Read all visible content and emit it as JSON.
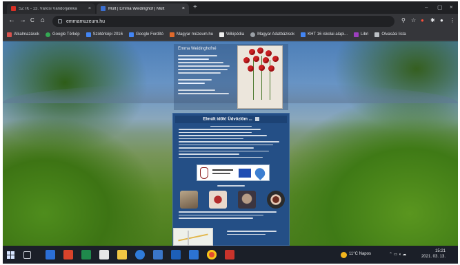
{
  "browser": {
    "tabs": [
      {
        "label": "SZTK - 13. Városi Vándorjátéka"
      },
      {
        "label": "Múlt | Emma Weidinghof | Múlt"
      }
    ],
    "new_tab": "+",
    "window_controls": {
      "minimize": "–",
      "maximize": "▢",
      "close": "×"
    },
    "nav": {
      "back": "←",
      "forward": "→",
      "reload": "C",
      "home": "⌂"
    },
    "url": "emmamuzeum.hu",
    "bookmarks": [
      {
        "label": "Alkalmazások",
        "color": "#d9534f"
      },
      {
        "label": "Google Térkép",
        "color": "#34a853"
      },
      {
        "label": "Szótérképi 2016",
        "color": "#4285f4"
      },
      {
        "label": "Google Fordító",
        "color": "#4285f4"
      },
      {
        "label": "Magyar múzeum.hu",
        "color": "#e06a2b"
      },
      {
        "label": "Wikipédia",
        "color": "#eeeeee"
      },
      {
        "label": "Magyar Adatbázisok",
        "color": "#9aa0a6"
      },
      {
        "label": "KHT 16 iskolai alapi...",
        "color": "#4285f4"
      },
      {
        "label": "Libri",
        "color": "#9c3fbf"
      },
      {
        "label": "Olvasási lista",
        "color": "#bdc1c6"
      }
    ]
  },
  "page": {
    "top_title": "Emma Weidinghofné",
    "section_title": "Elmúlt idők! Üdvözlöm ...",
    "colors": {
      "panel": "#244f86",
      "accent": "#c91f22"
    }
  },
  "taskbar": {
    "weather": "11°C Napos",
    "time": "15:21",
    "date": "2021. 03. 13."
  }
}
